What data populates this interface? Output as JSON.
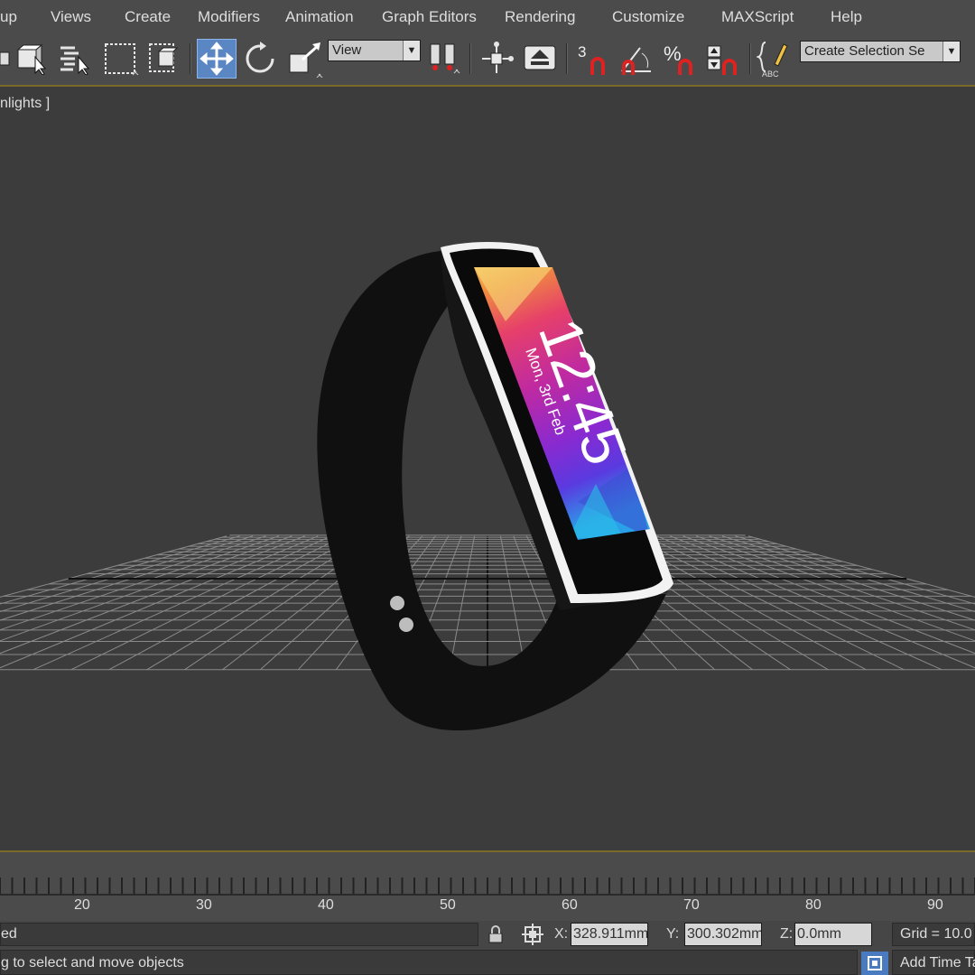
{
  "menu": [
    "up",
    "Views",
    "Create",
    "Modifiers",
    "Animation",
    "Graph Editors",
    "Rendering",
    "Customize",
    "MAXScript",
    "Help"
  ],
  "toolbar": {
    "reference_coord": "View",
    "selection_set": "Create Selection Se",
    "snap_3d_label": "3",
    "percent_snap_label": "%"
  },
  "viewport": {
    "label": "nlights ]"
  },
  "watch_screen": {
    "time": "12:45",
    "date": "Mon, 3rd Feb"
  },
  "timeline": {
    "ticks": [
      "20",
      "30",
      "40",
      "50",
      "60",
      "70",
      "80",
      "90"
    ]
  },
  "status": {
    "selection_text": "ed",
    "prompt": "g to select and move objects",
    "x_label": "X:",
    "x_value": "328.911mm",
    "y_label": "Y:",
    "y_value": "300.302mm",
    "z_label": "Z:",
    "z_value": "0.0mm",
    "grid": "Grid = 10.0",
    "add_time_tag": "Add Time Ta"
  },
  "colors": {
    "ui_bg": "#4b4b4b",
    "viewport_bg": "#3c3c3c",
    "active_tool": "#5b86c4",
    "accent_line": "#7a6a2a"
  }
}
